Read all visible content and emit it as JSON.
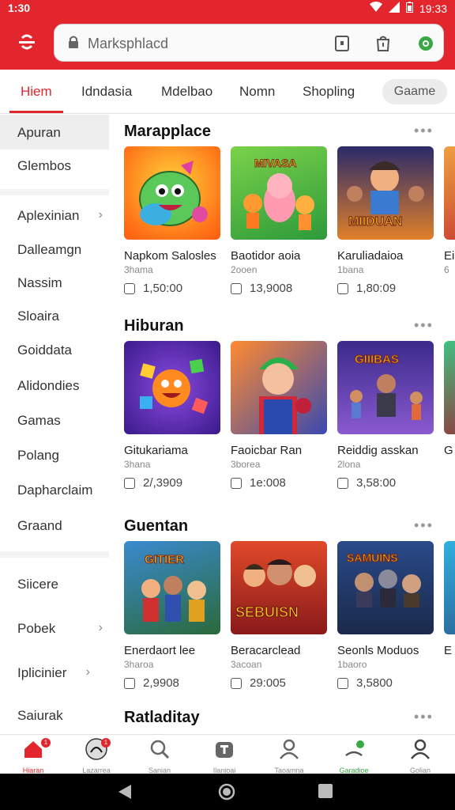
{
  "status": {
    "time": "1:30",
    "clock": "19:33"
  },
  "search": {
    "placeholder": "Marksphlacd"
  },
  "tabs": [
    {
      "label": "Hiem"
    },
    {
      "label": "Idndasia"
    },
    {
      "label": "Mdelbao"
    },
    {
      "label": "Nomn"
    },
    {
      "label": "Shopling"
    },
    {
      "label": "Gaame"
    }
  ],
  "sidebar": {
    "items": [
      {
        "label": "Apuran"
      },
      {
        "label": "Glembos"
      },
      {
        "label": "Aplexinian",
        "chevron": "›"
      },
      {
        "label": "Dalleamgn"
      },
      {
        "label": "Nassim"
      },
      {
        "label": "Sloaira"
      },
      {
        "label": "Goiddata"
      },
      {
        "label": "Alidondies"
      },
      {
        "label": "Gamas"
      },
      {
        "label": "Polang"
      },
      {
        "label": "Dapharclaim"
      },
      {
        "label": "Graand"
      },
      {
        "label": "Siicere"
      },
      {
        "label": "Pobek",
        "chevron": "›"
      },
      {
        "label": "Iplicinier",
        "chevron": "›"
      },
      {
        "label": "Saiurak"
      }
    ]
  },
  "sections": [
    {
      "title": "Marapplace",
      "more": "•••",
      "cards": [
        {
          "name": "Napkom Salosles",
          "sub": "3hama",
          "price": "1,50:00",
          "thumb_title": ""
        },
        {
          "name": "Baotidor aoia",
          "sub": "2ooen",
          "price": "13,9008",
          "thumb_title": "MIVASA"
        },
        {
          "name": "Karuliadaioa",
          "sub": "1bana",
          "price": "1,80:09",
          "thumb_title": "MIIDUAN"
        },
        {
          "name": "Ei",
          "sub": "6",
          "price": ""
        }
      ]
    },
    {
      "title": "Hiburan",
      "more": "•••",
      "cards": [
        {
          "name": "Gitukariama",
          "sub": "3hana",
          "price": "2/,3909",
          "thumb_title": ""
        },
        {
          "name": "Faoicbar Ran",
          "sub": "3borea",
          "price": "1e:008",
          "thumb_title": ""
        },
        {
          "name": "Reiddig asskan",
          "sub": "2lona",
          "price": "3,58:00",
          "thumb_title": "GIIIBAS"
        },
        {
          "name": "G",
          "sub": "",
          "price": ""
        }
      ]
    },
    {
      "title": "Guentan",
      "more": "•••",
      "cards": [
        {
          "name": "Enerdaort lee",
          "sub": "3haroa",
          "price": "2,9908",
          "thumb_title": "GITIER"
        },
        {
          "name": "Beracarclead",
          "sub": "3acoan",
          "price": "29:005",
          "thumb_title": "SEBUISN"
        },
        {
          "name": "Seonls Moduos",
          "sub": "1baoro",
          "price": "3,5800",
          "thumb_title": "SAMUINS"
        },
        {
          "name": "E",
          "sub": "",
          "price": ""
        }
      ]
    },
    {
      "title": "Ratladitay",
      "more": "•••",
      "cards": []
    }
  ],
  "bottomnav": [
    {
      "label": "Hiaran",
      "icon": "home-icon",
      "badge": "1"
    },
    {
      "label": "Lazarrea",
      "icon": "profile-logo-icon",
      "badge": "1"
    },
    {
      "label": "Sanian",
      "icon": "search-icon"
    },
    {
      "label": "Ilanioai",
      "icon": "bag-icon"
    },
    {
      "label": "Taoamna",
      "icon": "person-icon"
    },
    {
      "label": "Garadioe",
      "icon": "chat-icon"
    },
    {
      "label": "Golian",
      "icon": "account-icon"
    }
  ],
  "colors": {
    "brand": "#e3262d",
    "price_accent": "#444444"
  }
}
